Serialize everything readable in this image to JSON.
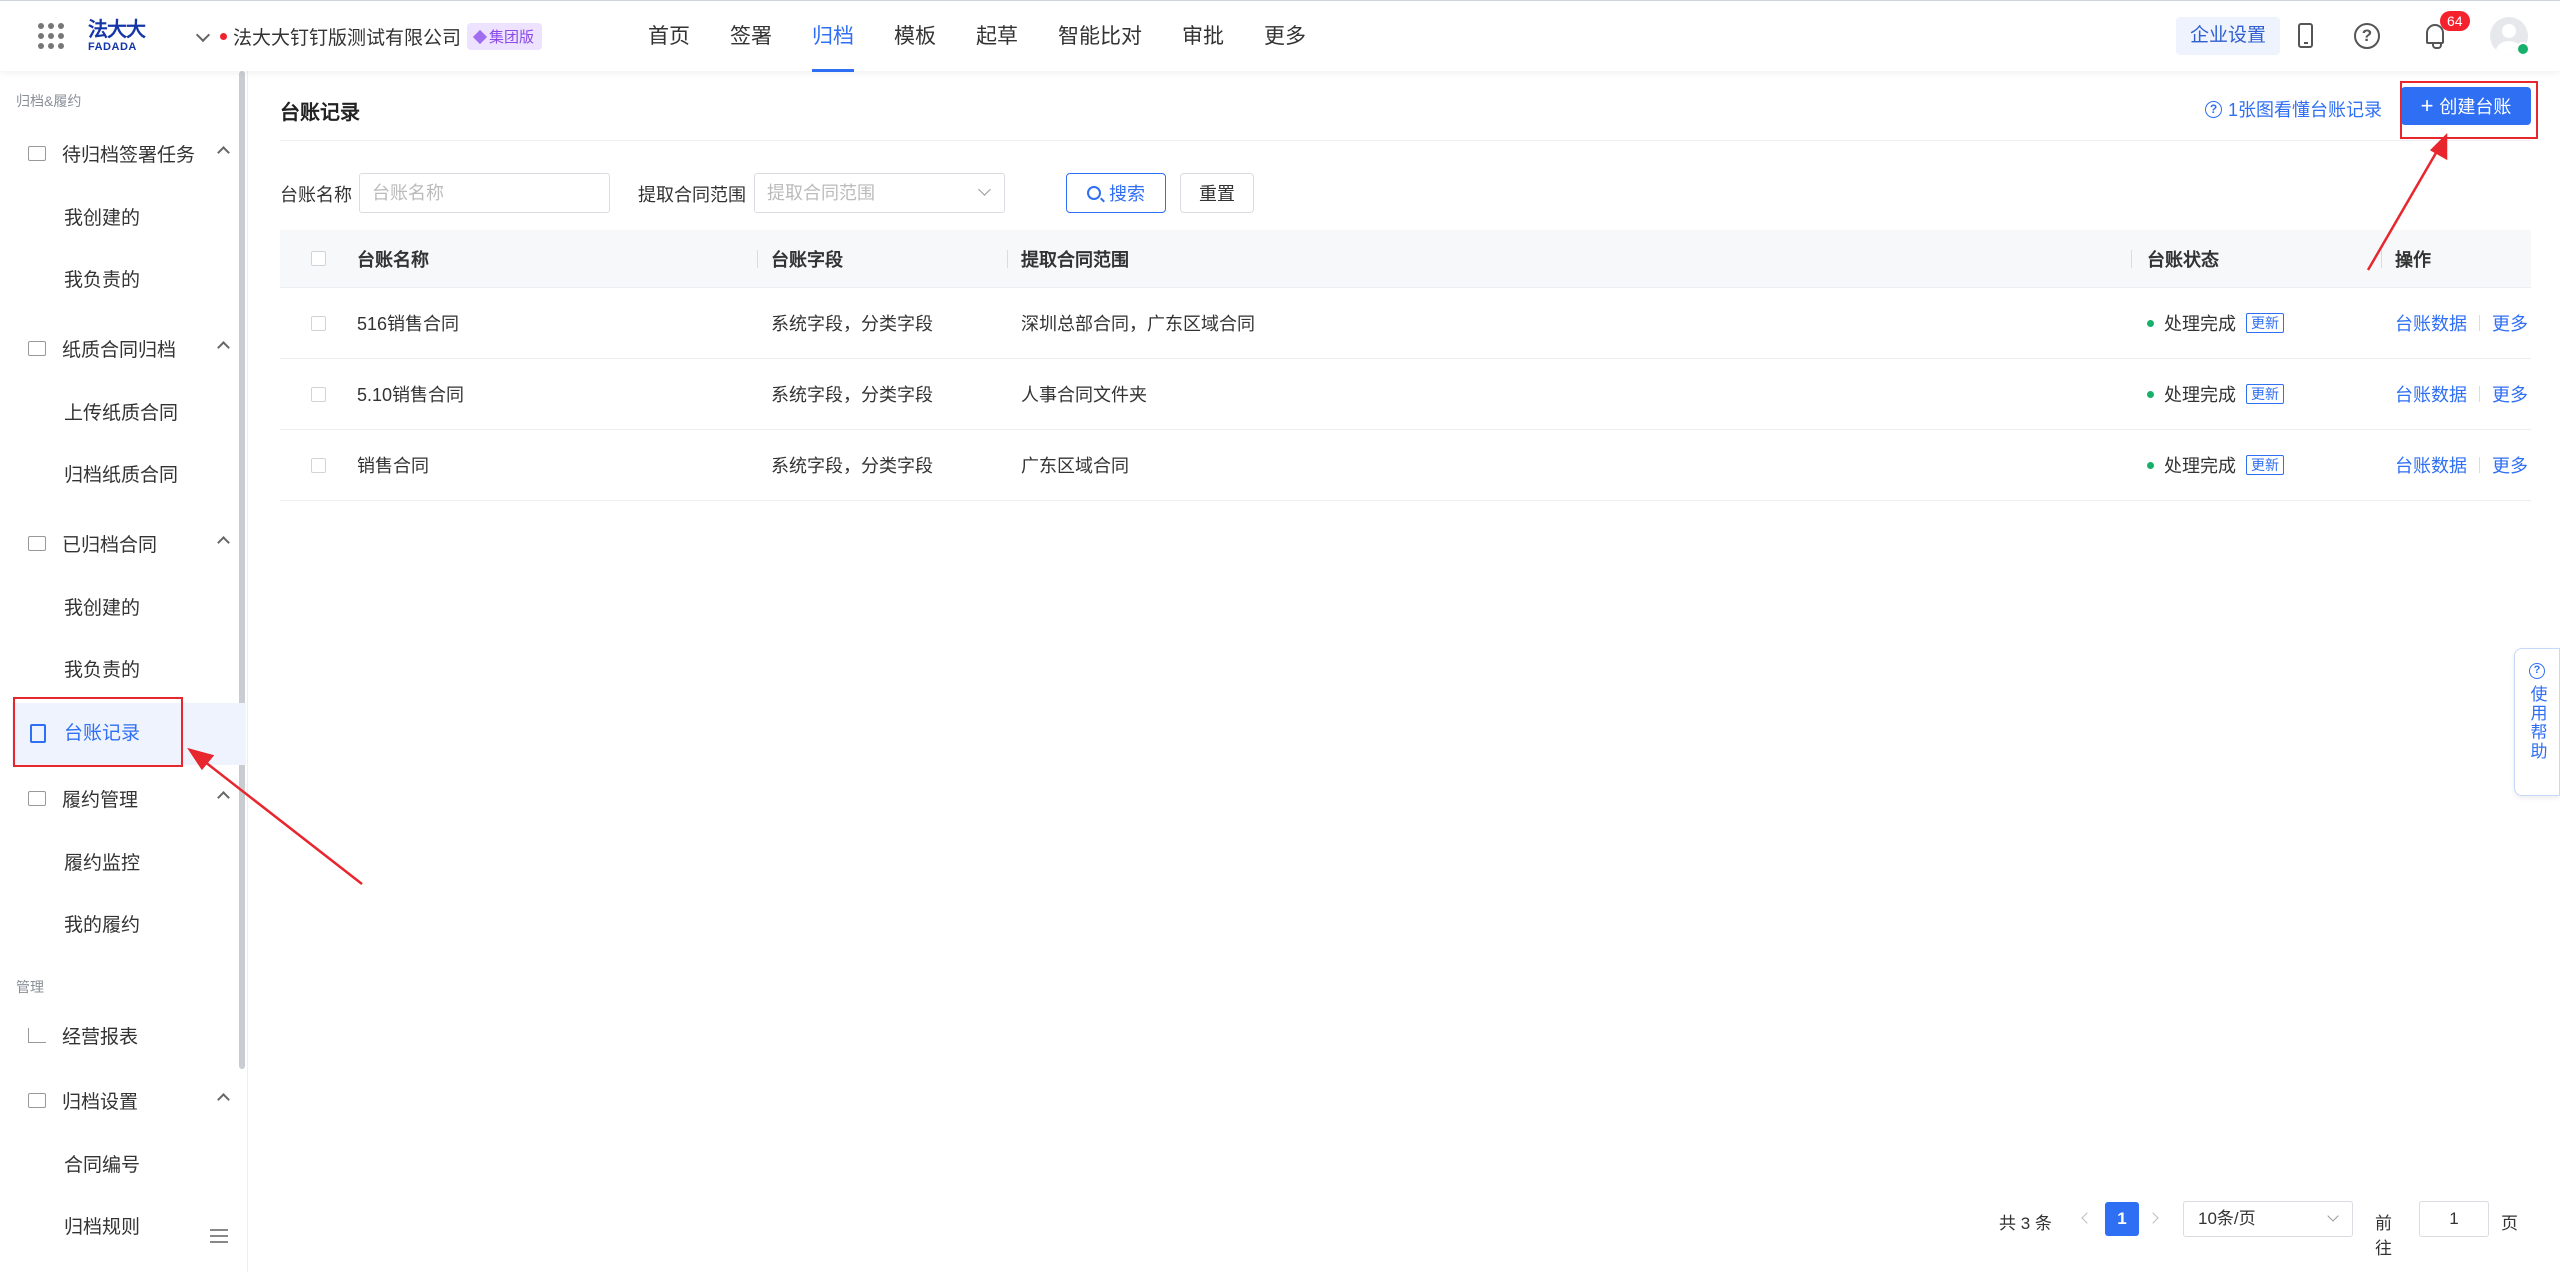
{
  "topbar": {
    "logo_cn": "法大大",
    "logo_en": "FADADA",
    "company": "法大大钉钉版测试有限公司",
    "badge": "集团版",
    "nav": [
      "首页",
      "签署",
      "归档",
      "模板",
      "起草",
      "智能比对",
      "审批",
      "更多"
    ],
    "active_nav": "归档",
    "enterprise_settings": "企业设置",
    "notification_count": "64",
    "icons": [
      "apps-grid-icon",
      "phone-icon",
      "help-icon",
      "bell-icon",
      "avatar"
    ]
  },
  "sidebar": {
    "section1": "归档&履约",
    "groups": [
      {
        "label": "待归档签署任务",
        "items": [
          "我创建的",
          "我负责的"
        ]
      },
      {
        "label": "纸质合同归档",
        "items": [
          "上传纸质合同",
          "归档纸质合同"
        ]
      },
      {
        "label": "已归档合同",
        "items": [
          "我创建的",
          "我负责的"
        ]
      },
      {
        "label": "台账记录",
        "items": []
      },
      {
        "label": "履约管理",
        "items": [
          "履约监控",
          "我的履约"
        ]
      }
    ],
    "active": "台账记录",
    "section2": "管理",
    "manage": [
      {
        "label": "经营报表",
        "items": []
      },
      {
        "label": "归档设置",
        "items": [
          "合同编号",
          "归档规则"
        ]
      }
    ]
  },
  "main": {
    "title": "台账记录",
    "guide_link": "1张图看懂台账记录",
    "create_button": "创建台账",
    "filter": {
      "name_label": "台账名称",
      "name_placeholder": "台账名称",
      "range_label": "提取合同范围",
      "range_placeholder": "提取合同范围",
      "search": "搜索",
      "reset": "重置"
    },
    "table": {
      "columns": [
        "台账名称",
        "台账字段",
        "提取合同范围",
        "台账状态",
        "操作"
      ],
      "rows": [
        {
          "name": "516销售合同",
          "fields": "系统字段，分类字段",
          "range": "深圳总部合同，广东区域合同",
          "status": "处理完成",
          "tag": "更新",
          "op1": "台账数据",
          "op2": "更多"
        },
        {
          "name": "5.10销售合同",
          "fields": "系统字段，分类字段",
          "range": "人事合同文件夹",
          "status": "处理完成",
          "tag": "更新",
          "op1": "台账数据",
          "op2": "更多"
        },
        {
          "name": "销售合同",
          "fields": "系统字段，分类字段",
          "range": "广东区域合同",
          "status": "处理完成",
          "tag": "更新",
          "op1": "台账数据",
          "op2": "更多"
        }
      ]
    },
    "pagination": {
      "total": "共 3 条",
      "current": "1",
      "page_size": "10条/页",
      "goto_label": "前往",
      "goto_value": "1",
      "goto_unit": "页"
    }
  },
  "help_float": {
    "text": "使用帮助"
  },
  "colors": {
    "primary": "#2f6ff4",
    "annotation": "#e8262d",
    "success": "#16b06a"
  }
}
